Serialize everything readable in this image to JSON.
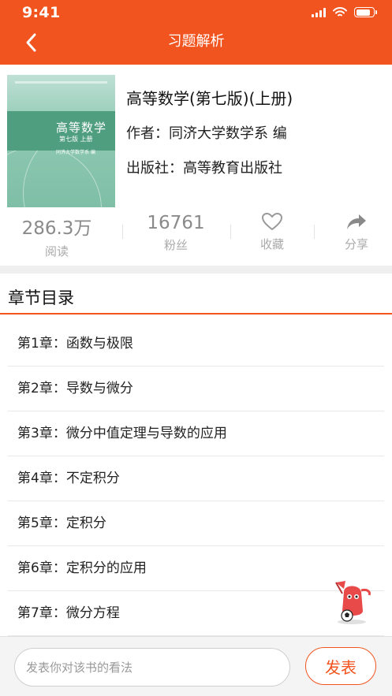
{
  "status_bar": {
    "time": "9:41",
    "battery_level": 0.85
  },
  "nav": {
    "title": "习题解析",
    "back_icon": "chevron-left-icon"
  },
  "book": {
    "title": "高等数学(第七版)(上册)",
    "author_line": "作者：同济大学数学系 编",
    "publisher_line": "出版社：高等教育出版社",
    "cover": {
      "top_text": "\"十二五\"普通高等教育本科国家级规划教材",
      "title": "高等数学",
      "edition": "第七版  上册",
      "author": "同济大学数学系  编"
    }
  },
  "stats": [
    {
      "value": "286.3万",
      "label": "阅读"
    },
    {
      "value": "16761",
      "label": "粉丝"
    }
  ],
  "actions": [
    {
      "label": "收藏",
      "icon": "heart-icon"
    },
    {
      "label": "分享",
      "icon": "share-icon"
    }
  ],
  "section_title": "章节目录",
  "chapters": [
    "第1章：函数与极限",
    "第2章：导数与微分",
    "第3章：微分中值定理与导数的应用",
    "第4章：不定积分",
    "第5章：定积分",
    "第6章：定积分的应用",
    "第7章：微分方程"
  ],
  "comment": {
    "placeholder": "发表你对该书的看法",
    "submit_label": "发表"
  },
  "colors": {
    "brand": "#f1541f",
    "muted_text": "#aaaaaa"
  }
}
